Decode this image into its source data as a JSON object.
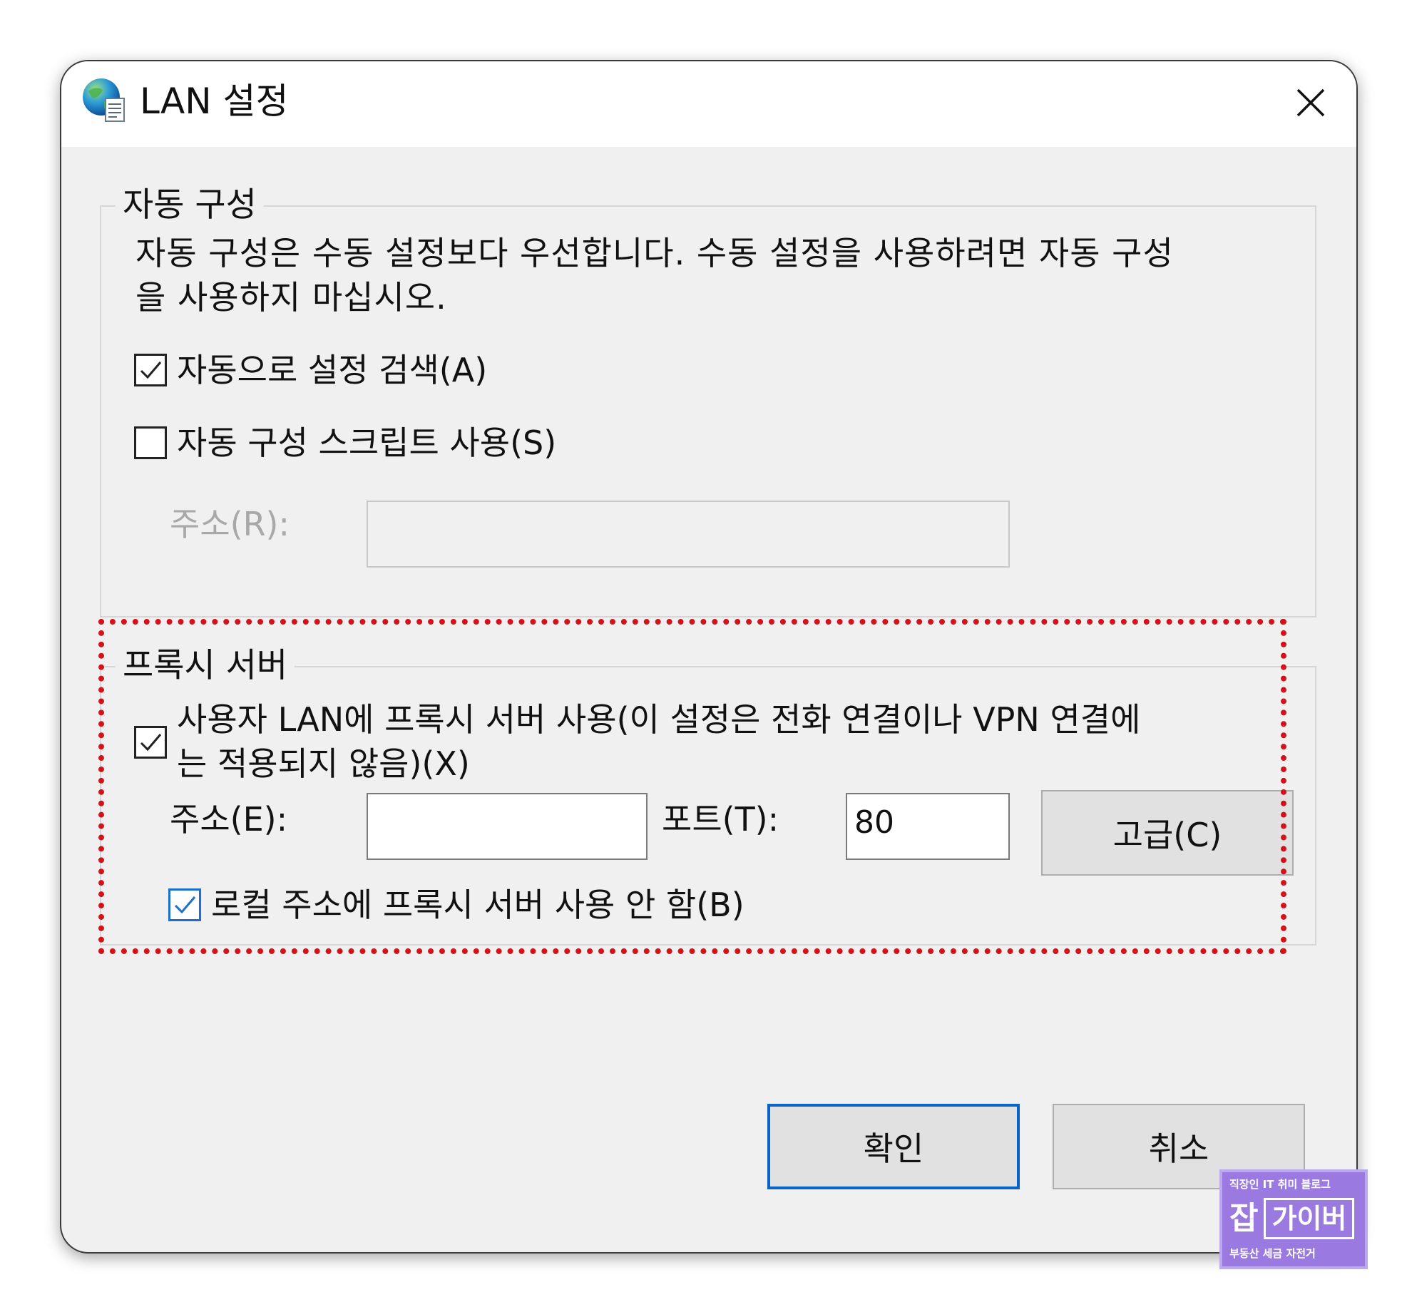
{
  "dialog": {
    "title": "LAN 설정"
  },
  "auto_config": {
    "legend": "자동 구성",
    "description_line1": "자동 구성은 수동 설정보다 우선합니다. 수동 설정을 사용하려면 자동 구성",
    "description_line2": "을 사용하지 마십시오.",
    "auto_detect_label": "자동으로 설정 검색(A)",
    "auto_detect_checked": true,
    "use_script_label": "자동 구성 스크립트 사용(S)",
    "use_script_checked": false,
    "address_label": "주소(R):",
    "address_value": ""
  },
  "proxy": {
    "legend": "프록시 서버",
    "use_proxy_label_line1": "사용자 LAN에 프록시 서버 사용(이 설정은 전화 연결이나 VPN 연결에",
    "use_proxy_label_line2": "는 적용되지 않음)(X)",
    "use_proxy_checked": true,
    "address_label": "주소(E):",
    "address_value": "",
    "port_label": "포트(T):",
    "port_value": "80",
    "advanced_button": "고급(C)",
    "bypass_local_label": "로컬 주소에 프록시 서버 사용 안 함(B)",
    "bypass_local_checked": true
  },
  "buttons": {
    "ok": "확인",
    "cancel": "취소"
  },
  "watermark": {
    "top_text": "직장인 IT 취미 블로그",
    "big_char": "잡",
    "box_text": "가이버",
    "bottom_text": "부동산 세금 자전거"
  },
  "colors": {
    "highlight_border": "#d4121a",
    "default_button_border": "#0a64c8",
    "checkbox_accent": "#1a6fd1",
    "watermark_bg": "#9a7ae0"
  },
  "icons": {
    "app": "globe-document-icon",
    "close": "close-icon",
    "check": "checkmark-icon"
  }
}
